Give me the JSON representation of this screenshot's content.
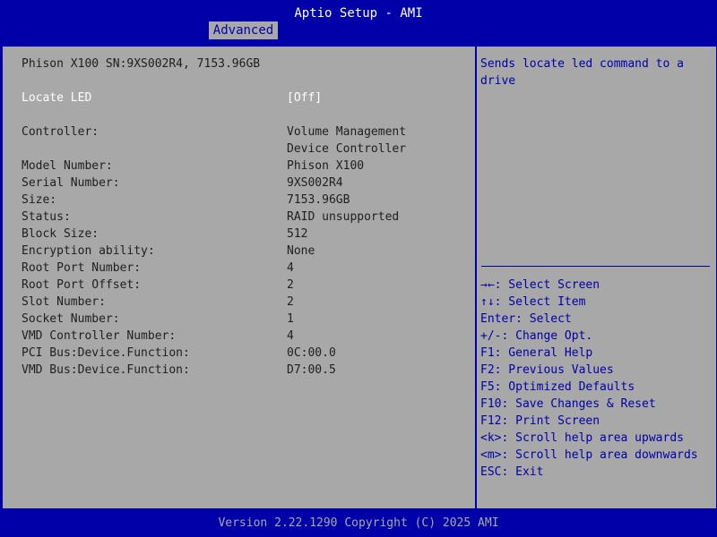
{
  "app": {
    "title": "Aptio Setup - AMI"
  },
  "tabs": [
    {
      "label": "Advanced"
    }
  ],
  "left": {
    "header": "Phison X100 SN:9XS002R4, 7153.96GB",
    "locate_led": {
      "label": "Locate LED",
      "value": "[Off]"
    },
    "controller": {
      "label": "Controller:",
      "value_line1": "Volume Management",
      "value_line2": "Device Controller"
    },
    "rows": [
      {
        "label": "Model Number:",
        "value": "Phison X100"
      },
      {
        "label": "Serial Number:",
        "value": "9XS002R4"
      },
      {
        "label": "Size:",
        "value": "7153.96GB"
      },
      {
        "label": "Status:",
        "value": "RAID unsupported"
      },
      {
        "label": "Block Size:",
        "value": "512"
      },
      {
        "label": "Encryption ability:",
        "value": "None"
      },
      {
        "label": "Root Port Number:",
        "value": "4"
      },
      {
        "label": "Root Port Offset:",
        "value": "2"
      },
      {
        "label": "Slot Number:",
        "value": "2"
      },
      {
        "label": "Socket Number:",
        "value": "1"
      },
      {
        "label": "VMD Controller Number:",
        "value": "4"
      },
      {
        "label": "PCI Bus:Device.Function:",
        "value": "0C:00.0"
      },
      {
        "label": "VMD Bus:Device.Function:",
        "value": "D7:00.5"
      }
    ]
  },
  "help": {
    "text_line1": "Sends locate led command to a",
    "text_line2": "drive",
    "keys": [
      "→←: Select Screen",
      "↑↓: Select Item",
      "Enter: Select",
      "+/-: Change Opt.",
      "F1: General Help",
      "F2: Previous Values",
      "F5: Optimized Defaults",
      "F10: Save Changes & Reset",
      "F12: Print Screen",
      "<k>: Scroll help area upwards",
      "<m>: Scroll help area downwards",
      "ESC: Exit"
    ]
  },
  "footer": {
    "text": "Version 2.22.1290 Copyright (C) 2025 AMI"
  },
  "colors": {
    "background": "#0000a8",
    "panel": "#a8a8a8",
    "highlight": "#ffffff",
    "text": "#202020"
  }
}
